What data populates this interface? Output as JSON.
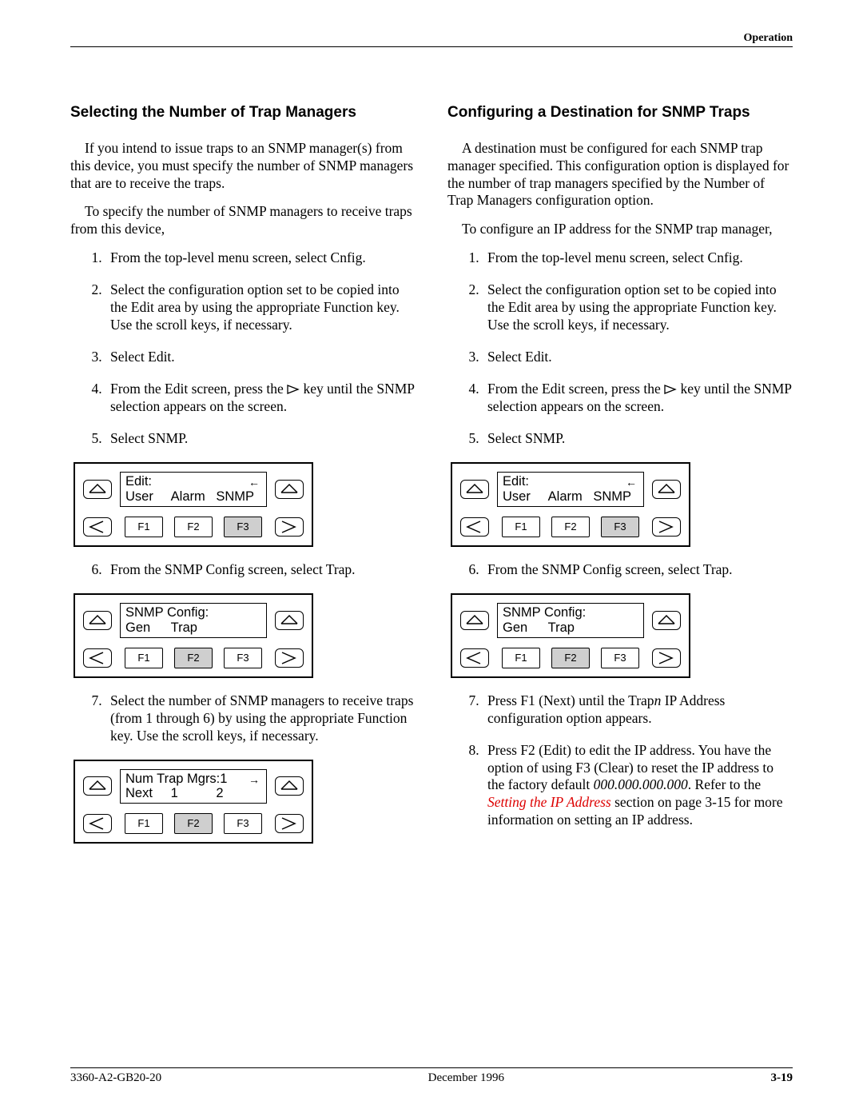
{
  "running_head": "Operation",
  "footer": {
    "doc": "3360-A2-GB20-20",
    "date": "December 1996",
    "page": "3-19"
  },
  "left": {
    "title": "Selecting the Number of Trap Managers",
    "p1": "If you intend to issue traps to an SNMP manager(s) from this device, you must specify the number of SNMP managers that are to receive the traps.",
    "p2": "To specify the number of SNMP managers to receive traps from this device,",
    "s1": "From the top-level menu screen, select Cnfig.",
    "s2": "Select the configuration option set to be copied into the Edit area by using the appropriate Function key. Use the scroll keys, if necessary.",
    "s3": "Select Edit.",
    "s4a": "From the Edit screen, press the ",
    "s4b": " key until the SNMP selection appears on the screen.",
    "s5": "Select SNMP.",
    "s6": "From the SNMP Config screen, select Trap.",
    "s7": "Select the number of SNMP managers to receive traps (from 1 through 6) by using the appropriate Function key. Use the scroll keys, if necessary.",
    "panel_edit": {
      "line1": "Edit:",
      "opts": [
        "User",
        "Alarm",
        "SNMP"
      ],
      "arrow": "←",
      "hl": 3,
      "fkeys": [
        "F1",
        "F2",
        "F3"
      ]
    },
    "panel_snmp": {
      "line1": "SNMP Config:",
      "opts": [
        "Gen",
        "Trap",
        ""
      ],
      "arrow": "",
      "hl": 2,
      "fkeys": [
        "F1",
        "F2",
        "F3"
      ]
    },
    "panel_num": {
      "line1": "Num Trap Mgrs:1",
      "opts": [
        "Next",
        "1",
        "2"
      ],
      "arrow": "→",
      "hl": 2,
      "fkeys": [
        "F1",
        "F2",
        "F3"
      ]
    }
  },
  "right": {
    "title": "Configuring a Destination for SNMP Traps",
    "p1": "A destination must be configured for each SNMP trap manager specified. This configuration option is displayed for the number of trap managers specified by the Number of Trap Managers configuration option.",
    "p2": "To configure an IP address for the SNMP trap manager,",
    "s1": "From the top-level menu screen, select Cnfig.",
    "s2": "Select the configuration option set to be copied into the Edit area by using the appropriate Function key. Use the scroll keys, if necessary.",
    "s3": "Select Edit.",
    "s4a": "From the Edit screen, press the ",
    "s4b": " key until the SNMP selection appears on the screen.",
    "s5": "Select SNMP.",
    "s6": "From the SNMP Config screen, select Trap.",
    "s7a": "Press F1 (Next) until the Trap",
    "s7n": "n",
    "s7b": " IP Address configuration option appears.",
    "s8a": "Press F2 (Edit) to edit the IP address. You have the option of using F3 (Clear) to reset the IP address to the factory default ",
    "s8def": "000.000.000.000",
    "s8b": ". Refer to the ",
    "s8link": "Setting the IP Address",
    "s8c": " section on page 3-15 for more information on setting an IP address.",
    "panel_edit": {
      "line1": "Edit:",
      "opts": [
        "User",
        "Alarm",
        "SNMP"
      ],
      "arrow": "←",
      "hl": 3,
      "fkeys": [
        "F1",
        "F2",
        "F3"
      ]
    },
    "panel_snmp": {
      "line1": "SNMP Config:",
      "opts": [
        "Gen",
        "Trap",
        ""
      ],
      "arrow": "",
      "hl": 2,
      "fkeys": [
        "F1",
        "F2",
        "F3"
      ]
    }
  }
}
